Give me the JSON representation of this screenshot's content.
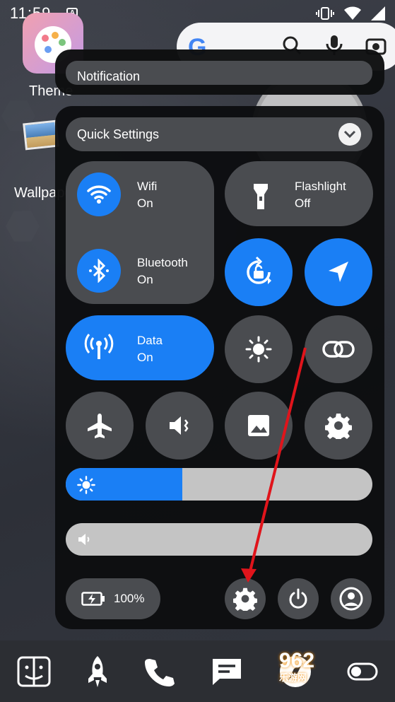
{
  "status_bar": {
    "time": "11:59"
  },
  "home": {
    "app_theme_label": "Theme",
    "app_wallpaper_label": "Wallpape"
  },
  "notification": {
    "title": "Notification"
  },
  "quick_settings": {
    "title": "Quick Settings",
    "wifi": {
      "label": "Wifi",
      "state": "On"
    },
    "bluetooth": {
      "label": "Bluetooth",
      "state": "On"
    },
    "flashlight": {
      "label": "Flashlight",
      "state": "Off"
    },
    "data": {
      "label": "Data",
      "state": "On"
    },
    "brightness_level": 0.38,
    "volume_level": 0.0,
    "battery": "100%"
  },
  "dock": {
    "watermark": "962",
    "watermark_sub": "乐游网"
  },
  "colors": {
    "accent": "#1a7ff5",
    "annotation": "#e0141b"
  }
}
